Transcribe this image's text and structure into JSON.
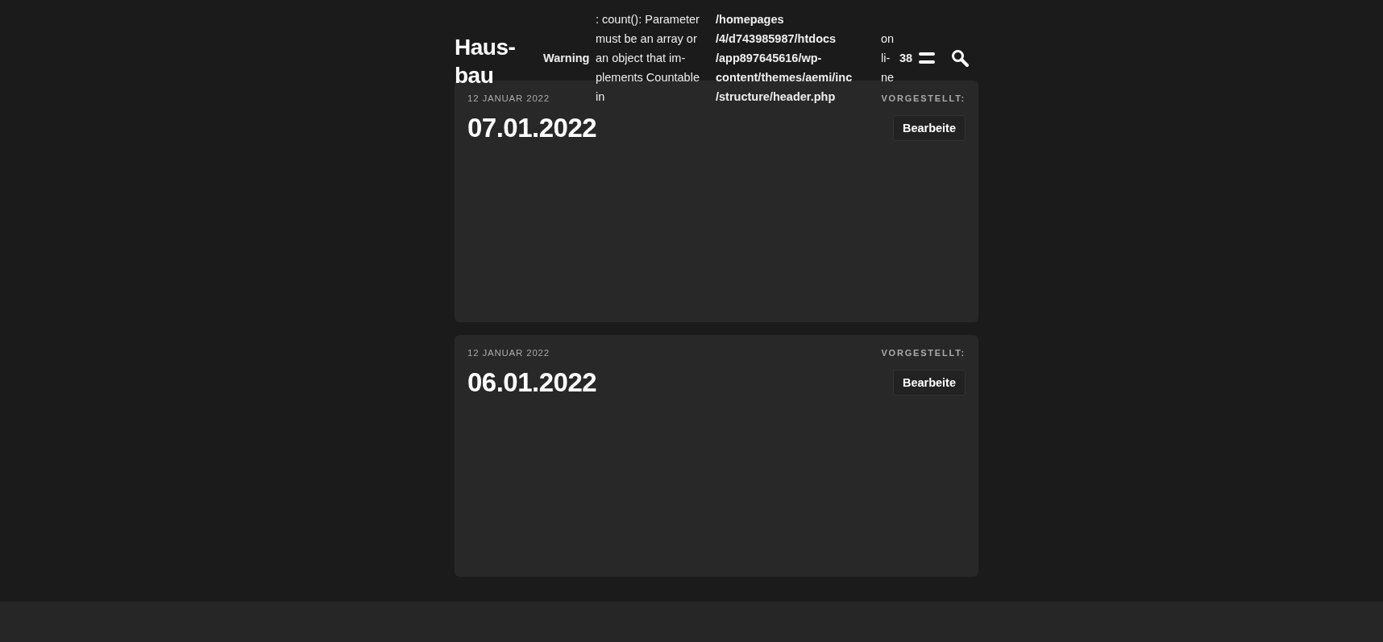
{
  "site": {
    "title_lines": [
      "Haus-",
      "bau"
    ]
  },
  "notice": {
    "label": "Warning",
    "message_lines": [
      ": count(): Parameter",
      "must be an array or",
      "an object that im-",
      "plements Countable",
      "in"
    ],
    "path_lines": [
      "/homepages",
      "/4/d743985987/htdocs",
      "/app897645616/wp-",
      "content/themes/aemi/inc",
      "/structure/header.php"
    ],
    "on_lines": [
      "on",
      "li-",
      "ne"
    ],
    "line_number": "38"
  },
  "posts": [
    {
      "date": "12 JANUAR 2022",
      "title": "07.01.2022",
      "featured_label": "VORGESTELLT:",
      "edit_button": "Bearbeite"
    },
    {
      "date": "12 JANUAR 2022",
      "title": "06.01.2022",
      "featured_label": "VORGESTELLT:",
      "edit_button": "Bearbeite"
    }
  ]
}
